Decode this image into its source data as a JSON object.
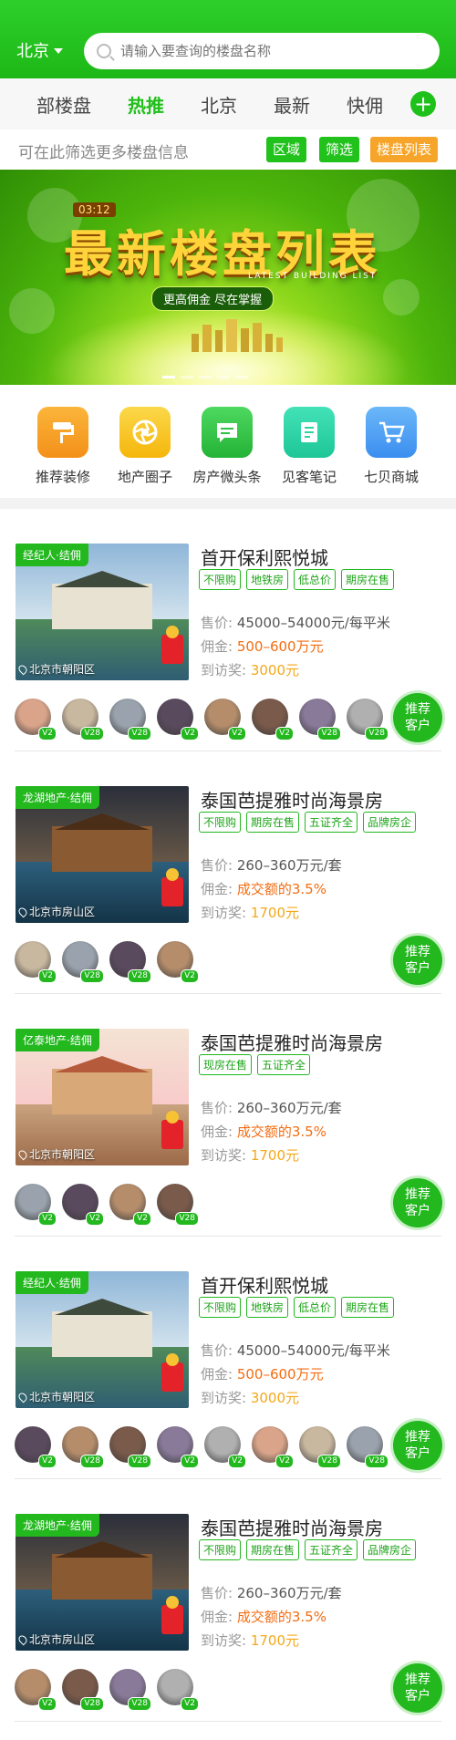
{
  "header": {
    "city": "北京",
    "search_placeholder": "请输入要查询的楼盘名称"
  },
  "tabs": [
    {
      "label": "部楼盘",
      "active": false
    },
    {
      "label": "热推",
      "active": true
    },
    {
      "label": "北京",
      "active": false
    },
    {
      "label": "最新",
      "active": false
    },
    {
      "label": "快佣",
      "active": false
    }
  ],
  "filter": {
    "hint": "可在此筛选更多楼盘信息",
    "buttons": [
      "区域",
      "筛选",
      "楼盘列表"
    ]
  },
  "banner": {
    "time": "03:12",
    "title": "最新楼盘列表",
    "subtitle": "LATEST BUILDING LIST",
    "slogan": "更高佣金  尽在掌握"
  },
  "quicknav": [
    {
      "label": "推荐装修",
      "icon": "paint-roller-icon",
      "color": "#f7a21b"
    },
    {
      "label": "地产圈子",
      "icon": "aperture-icon",
      "color": "#f9c612"
    },
    {
      "label": "房产微头条",
      "icon": "message-icon",
      "color": "#34c84a"
    },
    {
      "label": "见客笔记",
      "icon": "note-icon",
      "color": "#27d6a4"
    },
    {
      "label": "七贝商城",
      "icon": "cart-icon",
      "color": "#4aa1f2"
    }
  ],
  "labels": {
    "price": "售价:",
    "commission": "佣金:",
    "visit": "到访奖:",
    "recommend_line1": "推荐",
    "recommend_line2": "客户"
  },
  "listings": [
    {
      "agent_tag": "经纪人·结佣",
      "title": "首开保利熙悦城",
      "tags": [
        "不限购",
        "地铁房",
        "低总价",
        "期房在售"
      ],
      "price": "45000–54000元/每平米",
      "commission": "500–600万元",
      "visit_reward": "3000元",
      "location": "北京市朝阳区",
      "avatars": [
        "V2",
        "V28",
        "V28",
        "V2",
        "V2",
        "V2",
        "V28",
        "V28"
      ]
    },
    {
      "agent_tag": "龙湖地产·结佣",
      "title": "泰国芭提雅时尚海景房",
      "tags": [
        "不限购",
        "期房在售",
        "五证齐全",
        "品牌房企"
      ],
      "price": "260–360万元/套",
      "commission": "成交额的3.5%",
      "visit_reward": "1700元",
      "location": "北京市房山区",
      "avatars": [
        "V2",
        "V28",
        "V28",
        "V2"
      ]
    },
    {
      "agent_tag": "亿泰地产·结佣",
      "title": "泰国芭提雅时尚海景房",
      "tags": [
        "现房在售",
        "五证齐全"
      ],
      "price": "260–360万元/套",
      "commission": "成交额的3.5%",
      "visit_reward": "1700元",
      "location": "北京市朝阳区",
      "avatars": [
        "V2",
        "V2",
        "V2",
        "V28"
      ]
    },
    {
      "agent_tag": "经纪人·结佣",
      "title": "首开保利熙悦城",
      "tags": [
        "不限购",
        "地铁房",
        "低总价",
        "期房在售"
      ],
      "price": "45000–54000元/每平米",
      "commission": "500–600万元",
      "visit_reward": "3000元",
      "location": "北京市朝阳区",
      "avatars": [
        "V2",
        "V28",
        "V28",
        "V2",
        "V2",
        "V2",
        "V28",
        "V28"
      ]
    },
    {
      "agent_tag": "龙湖地产·结佣",
      "title": "泰国芭提雅时尚海景房",
      "tags": [
        "不限购",
        "期房在售",
        "五证齐全",
        "品牌房企"
      ],
      "price": "260–360万元/套",
      "commission": "成交额的3.5%",
      "visit_reward": "1700元",
      "location": "北京市房山区",
      "avatars": [
        "V2",
        "V28",
        "V28",
        "V2"
      ]
    }
  ]
}
